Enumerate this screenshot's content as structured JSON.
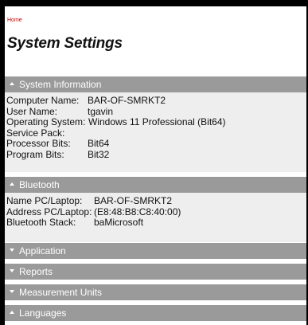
{
  "breadcrumb": {
    "home_label": "Home"
  },
  "page": {
    "title": "System Settings"
  },
  "sections": {
    "system_information": {
      "title": "System Information",
      "rows": [
        {
          "key": "Computer Name:",
          "value": "BAR-OF-SMRKT2"
        },
        {
          "key": "User Name:",
          "value": "tgavin"
        },
        {
          "key": "Operating System:",
          "value": "Windows 11 Professional (Bit64)"
        },
        {
          "key": "Service Pack:",
          "value": ""
        },
        {
          "key": "Processor Bits:",
          "value": "Bit64"
        },
        {
          "key": "Program Bits:",
          "value": "Bit32"
        }
      ]
    },
    "bluetooth": {
      "title": "Bluetooth",
      "rows": [
        {
          "key": "Name PC/Laptop:",
          "value": "BAR-OF-SMRKT2"
        },
        {
          "key": "Address PC/Laptop:",
          "value": "(E8:48:B8:C8:40:00)"
        },
        {
          "key": "Bluetooth Stack:",
          "value": "baMicrosoft"
        }
      ]
    },
    "application": {
      "title": "Application"
    },
    "reports": {
      "title": "Reports"
    },
    "measurement_units": {
      "title": "Measurement Units"
    },
    "languages": {
      "title": "Languages"
    }
  },
  "icons": {
    "expanded": "caret-up-icon",
    "collapsed": "caret-down-icon"
  },
  "colors": {
    "header_bg": "#9a9a9a",
    "body_bg": "#eeeeee",
    "breadcrumb": "#cc0000"
  }
}
